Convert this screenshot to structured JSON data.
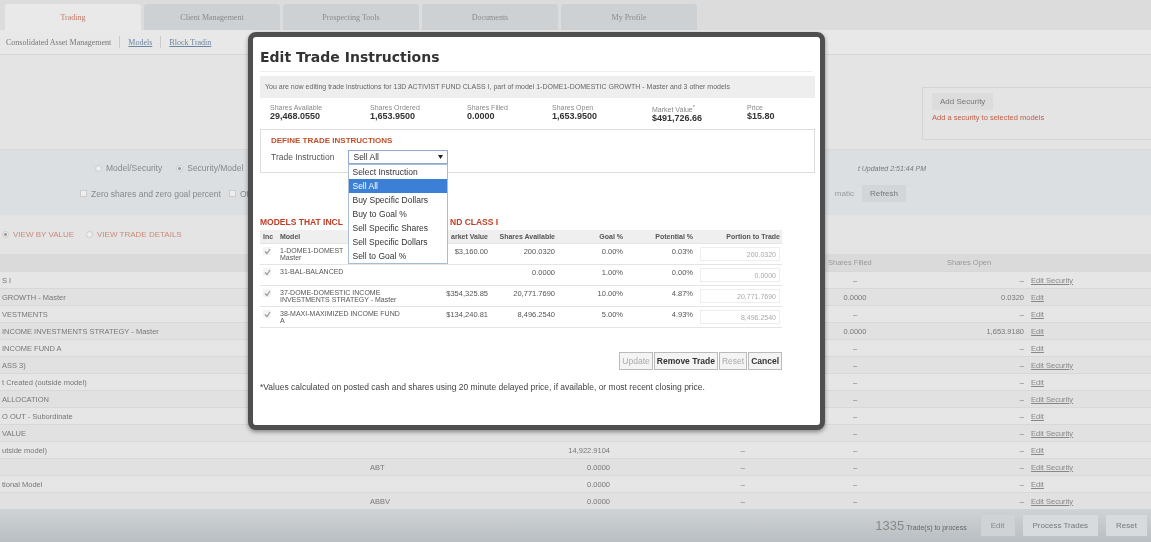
{
  "tabs": [
    {
      "label": "Trading",
      "selected": true
    },
    {
      "label": "Client Management",
      "selected": false
    },
    {
      "label": "Prospecting Tools",
      "selected": false
    },
    {
      "label": "Documents",
      "selected": false
    },
    {
      "label": "My Profile",
      "selected": false
    }
  ],
  "subnav": [
    {
      "label": "Consolidated Asset Management",
      "kind": "text"
    },
    {
      "label": "Models",
      "kind": "link"
    },
    {
      "label": "Block Tradin",
      "kind": "link"
    }
  ],
  "add_security": {
    "button": "Add Security",
    "hint": "Add a security to selected models"
  },
  "display_options": [
    {
      "label": "Model/Security",
      "selected": false
    },
    {
      "label": "Security/Model",
      "selected": true
    }
  ],
  "filters": [
    {
      "label": "Zero shares and zero goal percent",
      "checked": false
    },
    {
      "label": "Ot",
      "checked": false
    }
  ],
  "last_updated": "t Updated 2:51:44 PM",
  "refresh_label": "matic",
  "refresh_button": "Refresh",
  "view_modes": [
    {
      "label": "VIEW BY VALUE",
      "selected": true
    },
    {
      "label": "VIEW TRADE DETAILS",
      "selected": false
    }
  ],
  "table": {
    "columns": {
      "shares_filled": "Shares Filled",
      "shares_open": "Shares Open"
    },
    "rows": [
      {
        "name": "S I",
        "shares_filled": "–",
        "shares_open": "–",
        "action": "Edit Security"
      },
      {
        "name": "GROWTH - Master",
        "shares_filled": "0.0000",
        "shares_open": "0.0320",
        "action": "Edit"
      },
      {
        "name": "VESTMENTS",
        "shares_filled": "–",
        "shares_open": "–",
        "action": "Edit"
      },
      {
        "name": "INCOME INVESTMENTS STRATEGY - Master",
        "shares_filled": "0.0000",
        "shares_open": "1,653.9180",
        "action": "Edit"
      },
      {
        "name": "INCOME FUND A",
        "shares_filled": "–",
        "shares_open": "–",
        "action": "Edit"
      },
      {
        "name": "ASS 3)",
        "shares_filled": "–",
        "shares_open": "–",
        "action": "Edit Security"
      },
      {
        "name": "t Created (outside model)",
        "shares_filled": "–",
        "shares_open": "–",
        "action": "Edit"
      },
      {
        "name": "ALLOCATION",
        "shares_filled": "–",
        "shares_open": "–",
        "action": "Edit Security"
      },
      {
        "name": "O OUT - Subordinate",
        "shares_filled": "–",
        "shares_open": "–",
        "action": "Edit"
      },
      {
        "name": "VALUE",
        "shares_filled": "–",
        "shares_open": "–",
        "action": "Edit Security"
      },
      {
        "name": "utside model)",
        "column_3": "14,922.9104",
        "column_4": "–",
        "shares_filled": "–",
        "shares_open": "–",
        "action": "Edit"
      },
      {
        "ticker": "ABT",
        "column_3": "0.0000",
        "column_4": "–",
        "shares_filled": "–",
        "shares_open": "–",
        "action": "Edit Security"
      },
      {
        "name": "tional Model",
        "column_3": "0.0000",
        "column_4": "–",
        "shares_filled": "–",
        "shares_open": "–",
        "action": "Edit"
      },
      {
        "ticker": "ABBV",
        "column_3": "0.0000",
        "column_4": "–",
        "shares_filled": "–",
        "shares_open": "–",
        "action": "Edit Security"
      }
    ]
  },
  "footer": {
    "count": "1335",
    "count_label": "Trade(s) to process",
    "buttons": [
      {
        "label": "Edit",
        "disabled": true
      },
      {
        "label": "Process Trades",
        "disabled": false
      },
      {
        "label": "Reset",
        "disabled": false
      }
    ]
  },
  "modal": {
    "title": "Edit Trade Instructions",
    "notice": "You are now editing trade instructions for 13D ACTIVIST FUND CLASS I, part of model 1-DOME1-DOMESTIC GROWTH - Master and 3 other models",
    "stats": [
      {
        "label": "Shares Available",
        "value": "29,468.0550"
      },
      {
        "label": "Shares Ordered",
        "value": "1,653.9500"
      },
      {
        "label": "Shares Filled",
        "value": "0.0000"
      },
      {
        "label": "Shares Open",
        "value": "1,653.9500"
      },
      {
        "label": "Market Value$^{*}$",
        "value": "$491,726.66"
      },
      {
        "label": "Price",
        "value": "$15.80"
      }
    ],
    "define_heading": "DEFINE TRADE INSTRUCTIONS",
    "instruction_label": "Trade Instruction",
    "instruction_value": "Sell All",
    "options": [
      {
        "label": "Select Instruction",
        "selected": false
      },
      {
        "label": "Sell All",
        "selected": true
      },
      {
        "label": "Buy Specific Dollars",
        "selected": false
      },
      {
        "label": "Buy to Goal %",
        "selected": false
      },
      {
        "label": "Sell Specific Shares",
        "selected": false
      },
      {
        "label": "Sell Specific Dollars",
        "selected": false
      },
      {
        "label": "Sell to Goal %",
        "selected": false
      }
    ],
    "models_heading": [
      "MODELS THAT INCL",
      "ND CLASS I"
    ],
    "columns": [
      "Inc",
      "Model",
      "arket Value",
      "Shares Available",
      "Goal %",
      "Potential %",
      "Portion to Trade"
    ],
    "rows": [
      {
        "included": true,
        "model": [
          "1-DOME1-DOMEST",
          "Master"
        ],
        "market_value": "$3,160.00",
        "shares_available": "200.0320",
        "goal": "0.00%",
        "potential": "0.03%",
        "portion": "200.0320"
      },
      {
        "included": true,
        "model": [
          "31-BAL-BALANCED"
        ],
        "shares_available": "0.0000",
        "goal": "1.00%",
        "potential": "0.00%",
        "portion": "0.0000"
      },
      {
        "included": true,
        "model": [
          "37-DOME-DOMESTIC INCOME",
          "INVESTMENTS STRATEGY - Master"
        ],
        "market_value": "$354,325.85",
        "shares_available": "20,771.7690",
        "goal": "10.00%",
        "potential": "4.87%",
        "portion": "20,771.7690"
      },
      {
        "included": true,
        "model": [
          "38-MAXI-MAXIMIZED INCOME FUND",
          "A"
        ],
        "market_value": "$134,240.81",
        "shares_available": "8,496.2540",
        "goal": "5.00%",
        "potential": "4.93%",
        "portion": "8,496.2540"
      }
    ],
    "buttons": [
      {
        "label": "Update",
        "disabled": true
      },
      {
        "label": "Remove Trade",
        "disabled": false
      },
      {
        "label": "Reset",
        "disabled": true
      },
      {
        "label": "Cancel",
        "disabled": false
      }
    ],
    "footnote": "*Values calculated on posted cash and shares using 20 minute delayed price, if available, or most recent closing price."
  }
}
